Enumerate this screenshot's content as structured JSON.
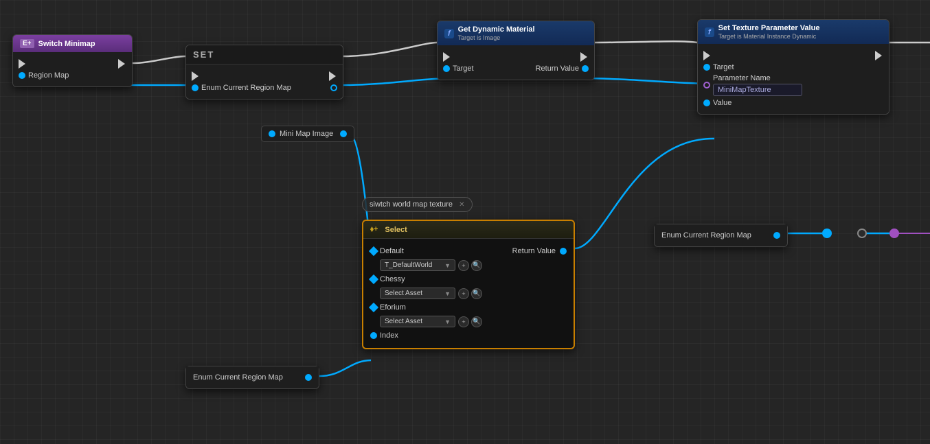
{
  "canvas": {
    "bg_color": "#252525"
  },
  "nodes": {
    "switch_minimap": {
      "title": "Switch Minimap",
      "pin_region_map": "Region Map"
    },
    "set_node": {
      "title": "SET",
      "pin_enum": "Enum Current Region Map"
    },
    "get_dynamic_material": {
      "title": "Get Dynamic Material",
      "subtitle": "Target is Image",
      "pin_target": "Target",
      "pin_return": "Return Value"
    },
    "set_texture": {
      "title": "Set Texture Parameter Value",
      "subtitle": "Target is Material Instance Dynamic",
      "pin_target": "Target",
      "pin_param_name_label": "Parameter Name",
      "pin_param_name_value": "MiniMapTexture",
      "pin_value": "Value"
    },
    "comment_label": "siwtch world map texture",
    "select_node": {
      "title": "Select",
      "title_icon": "⬧+",
      "row_default_label": "Default",
      "row_default_value": "T_DefaultWorld",
      "row_return_label": "Return Value",
      "row_chessy_label": "Chessy",
      "row_chessy_value": "Select Asset",
      "row_eforium_label": "Eforium",
      "row_eforium_value": "Select Asset",
      "pin_index": "Index"
    },
    "minimap_image": {
      "label": "Mini Map Image"
    },
    "enum_bottom": {
      "label": "Enum Current Region Map"
    },
    "enum_right": {
      "label": "Enum Current Region Map"
    }
  },
  "icons": {
    "function": "f",
    "set_icon": "≡",
    "exec": "▶",
    "circle": "●",
    "diamond_plus": "⬧+"
  }
}
